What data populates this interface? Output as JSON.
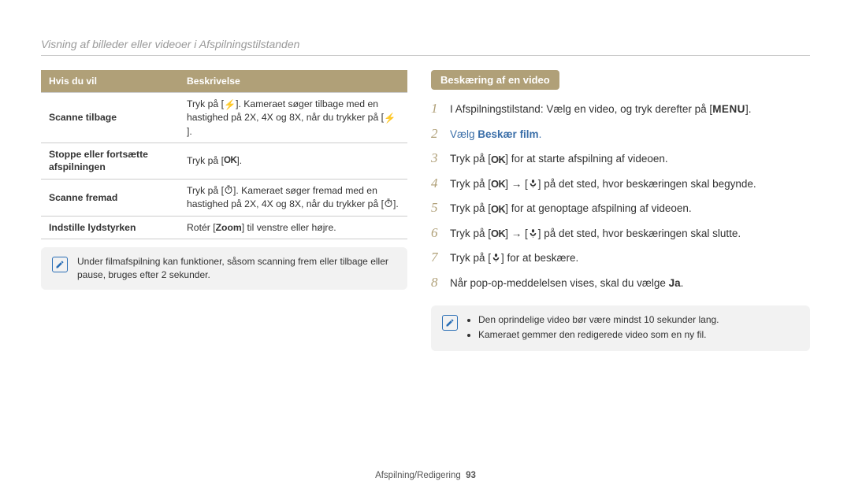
{
  "page_title": "Visning af billeder eller videoer i Afspilningstilstanden",
  "table": {
    "head": [
      "Hvis du vil",
      "Beskrivelse"
    ],
    "rows": [
      {
        "c1": "Scanne tilbage",
        "c2_pre": "Tryk på [",
        "c2_icon": "flash",
        "c2_mid": "]. Kameraet søger tilbage med en hastighed på 2X, 4X og 8X, når du trykker på [",
        "c2_icon2": "flash",
        "c2_post": "]."
      },
      {
        "c1": "Stoppe eller fortsætte afspilningen",
        "c2_pre": "Tryk på [",
        "c2_icon": "ok",
        "c2_mid": "",
        "c2_icon2": "",
        "c2_post": "]."
      },
      {
        "c1": "Scanne fremad",
        "c2_pre": "Tryk på [",
        "c2_icon": "timer",
        "c2_mid": "]. Kameraet søger fremad med en hastighed på 2X, 4X og 8X, når du trykker på [",
        "c2_icon2": "timer",
        "c2_post": "]."
      },
      {
        "c1": "Indstille lydstyrken",
        "c2_plain_pre": "Rotér [",
        "c2_strong": "Zoom",
        "c2_plain_post": "] til venstre eller højre."
      }
    ]
  },
  "note_left": "Under filmafspilning kan funktioner, såsom scanning frem eller tilbage eller pause, bruges efter 2 sekunder.",
  "section_right_title": "Beskæring af en video",
  "steps": [
    {
      "pre": "I Afspilningstilstand: Vælg en video, og tryk derefter på [",
      "icon": "menu",
      "post": "]."
    },
    {
      "pre": "Vælg ",
      "strong": "Beskær film",
      "post": "."
    },
    {
      "pre": "Tryk på [",
      "icon": "ok",
      "post": "] for at starte afspilning af videoen."
    },
    {
      "pre": "Tryk på [",
      "icon": "ok",
      "mid": "] → [",
      "icon2": "macro",
      "post": "] på det sted, hvor beskæringen skal begynde."
    },
    {
      "pre": "Tryk på [",
      "icon": "ok",
      "post": "] for at genoptage afspilning af videoen."
    },
    {
      "pre": "Tryk på [",
      "icon": "ok",
      "mid": "] → [",
      "icon2": "macro",
      "post": "] på det sted, hvor beskæringen skal slutte."
    },
    {
      "pre": "Tryk på [",
      "icon": "macro",
      "post": "] for at beskære."
    },
    {
      "pre": "Når pop-op-meddelelsen vises, skal du vælge ",
      "strong": "Ja",
      "post": "."
    }
  ],
  "note_right": [
    "Den oprindelige video bør være mindst 10 sekunder lang.",
    "Kameraet gemmer den redigerede video som en ny fil."
  ],
  "footer_section": "Afspilning/Redigering",
  "footer_page": "93"
}
